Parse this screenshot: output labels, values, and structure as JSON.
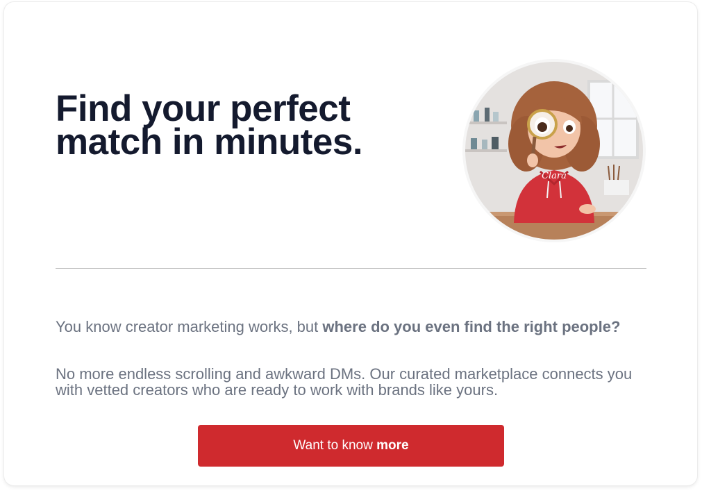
{
  "hero": {
    "headline": "Find your perfect match in minutes."
  },
  "illustration": {
    "hoodie_text": "Clara",
    "colors": {
      "hoodie": "#d2323a",
      "hair": "#a5623c",
      "background": "#e9e6e4"
    }
  },
  "content": {
    "lead_regular": "You know creator marketing works, but ",
    "lead_bold": "where do you even find the right people?",
    "body": "No more endless scrolling and awkward DMs. Our curated marketplace connects you with vetted creators who are ready to work with brands like yours."
  },
  "cta": {
    "label_regular": "Want to know ",
    "label_bold": "more",
    "color": "#cf2a2e"
  }
}
